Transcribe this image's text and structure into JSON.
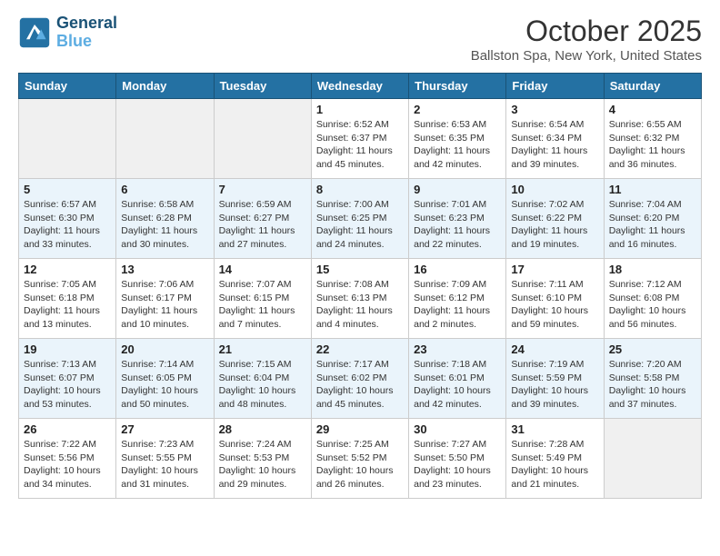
{
  "header": {
    "logo_line1": "General",
    "logo_line2": "Blue",
    "month": "October 2025",
    "location": "Ballston Spa, New York, United States"
  },
  "weekdays": [
    "Sunday",
    "Monday",
    "Tuesday",
    "Wednesday",
    "Thursday",
    "Friday",
    "Saturday"
  ],
  "weeks": [
    [
      {
        "day": "",
        "detail": ""
      },
      {
        "day": "",
        "detail": ""
      },
      {
        "day": "",
        "detail": ""
      },
      {
        "day": "1",
        "detail": "Sunrise: 6:52 AM\nSunset: 6:37 PM\nDaylight: 11 hours\nand 45 minutes."
      },
      {
        "day": "2",
        "detail": "Sunrise: 6:53 AM\nSunset: 6:35 PM\nDaylight: 11 hours\nand 42 minutes."
      },
      {
        "day": "3",
        "detail": "Sunrise: 6:54 AM\nSunset: 6:34 PM\nDaylight: 11 hours\nand 39 minutes."
      },
      {
        "day": "4",
        "detail": "Sunrise: 6:55 AM\nSunset: 6:32 PM\nDaylight: 11 hours\nand 36 minutes."
      }
    ],
    [
      {
        "day": "5",
        "detail": "Sunrise: 6:57 AM\nSunset: 6:30 PM\nDaylight: 11 hours\nand 33 minutes."
      },
      {
        "day": "6",
        "detail": "Sunrise: 6:58 AM\nSunset: 6:28 PM\nDaylight: 11 hours\nand 30 minutes."
      },
      {
        "day": "7",
        "detail": "Sunrise: 6:59 AM\nSunset: 6:27 PM\nDaylight: 11 hours\nand 27 minutes."
      },
      {
        "day": "8",
        "detail": "Sunrise: 7:00 AM\nSunset: 6:25 PM\nDaylight: 11 hours\nand 24 minutes."
      },
      {
        "day": "9",
        "detail": "Sunrise: 7:01 AM\nSunset: 6:23 PM\nDaylight: 11 hours\nand 22 minutes."
      },
      {
        "day": "10",
        "detail": "Sunrise: 7:02 AM\nSunset: 6:22 PM\nDaylight: 11 hours\nand 19 minutes."
      },
      {
        "day": "11",
        "detail": "Sunrise: 7:04 AM\nSunset: 6:20 PM\nDaylight: 11 hours\nand 16 minutes."
      }
    ],
    [
      {
        "day": "12",
        "detail": "Sunrise: 7:05 AM\nSunset: 6:18 PM\nDaylight: 11 hours\nand 13 minutes."
      },
      {
        "day": "13",
        "detail": "Sunrise: 7:06 AM\nSunset: 6:17 PM\nDaylight: 11 hours\nand 10 minutes."
      },
      {
        "day": "14",
        "detail": "Sunrise: 7:07 AM\nSunset: 6:15 PM\nDaylight: 11 hours\nand 7 minutes."
      },
      {
        "day": "15",
        "detail": "Sunrise: 7:08 AM\nSunset: 6:13 PM\nDaylight: 11 hours\nand 4 minutes."
      },
      {
        "day": "16",
        "detail": "Sunrise: 7:09 AM\nSunset: 6:12 PM\nDaylight: 11 hours\nand 2 minutes."
      },
      {
        "day": "17",
        "detail": "Sunrise: 7:11 AM\nSunset: 6:10 PM\nDaylight: 10 hours\nand 59 minutes."
      },
      {
        "day": "18",
        "detail": "Sunrise: 7:12 AM\nSunset: 6:08 PM\nDaylight: 10 hours\nand 56 minutes."
      }
    ],
    [
      {
        "day": "19",
        "detail": "Sunrise: 7:13 AM\nSunset: 6:07 PM\nDaylight: 10 hours\nand 53 minutes."
      },
      {
        "day": "20",
        "detail": "Sunrise: 7:14 AM\nSunset: 6:05 PM\nDaylight: 10 hours\nand 50 minutes."
      },
      {
        "day": "21",
        "detail": "Sunrise: 7:15 AM\nSunset: 6:04 PM\nDaylight: 10 hours\nand 48 minutes."
      },
      {
        "day": "22",
        "detail": "Sunrise: 7:17 AM\nSunset: 6:02 PM\nDaylight: 10 hours\nand 45 minutes."
      },
      {
        "day": "23",
        "detail": "Sunrise: 7:18 AM\nSunset: 6:01 PM\nDaylight: 10 hours\nand 42 minutes."
      },
      {
        "day": "24",
        "detail": "Sunrise: 7:19 AM\nSunset: 5:59 PM\nDaylight: 10 hours\nand 39 minutes."
      },
      {
        "day": "25",
        "detail": "Sunrise: 7:20 AM\nSunset: 5:58 PM\nDaylight: 10 hours\nand 37 minutes."
      }
    ],
    [
      {
        "day": "26",
        "detail": "Sunrise: 7:22 AM\nSunset: 5:56 PM\nDaylight: 10 hours\nand 34 minutes."
      },
      {
        "day": "27",
        "detail": "Sunrise: 7:23 AM\nSunset: 5:55 PM\nDaylight: 10 hours\nand 31 minutes."
      },
      {
        "day": "28",
        "detail": "Sunrise: 7:24 AM\nSunset: 5:53 PM\nDaylight: 10 hours\nand 29 minutes."
      },
      {
        "day": "29",
        "detail": "Sunrise: 7:25 AM\nSunset: 5:52 PM\nDaylight: 10 hours\nand 26 minutes."
      },
      {
        "day": "30",
        "detail": "Sunrise: 7:27 AM\nSunset: 5:50 PM\nDaylight: 10 hours\nand 23 minutes."
      },
      {
        "day": "31",
        "detail": "Sunrise: 7:28 AM\nSunset: 5:49 PM\nDaylight: 10 hours\nand 21 minutes."
      },
      {
        "day": "",
        "detail": ""
      }
    ]
  ]
}
